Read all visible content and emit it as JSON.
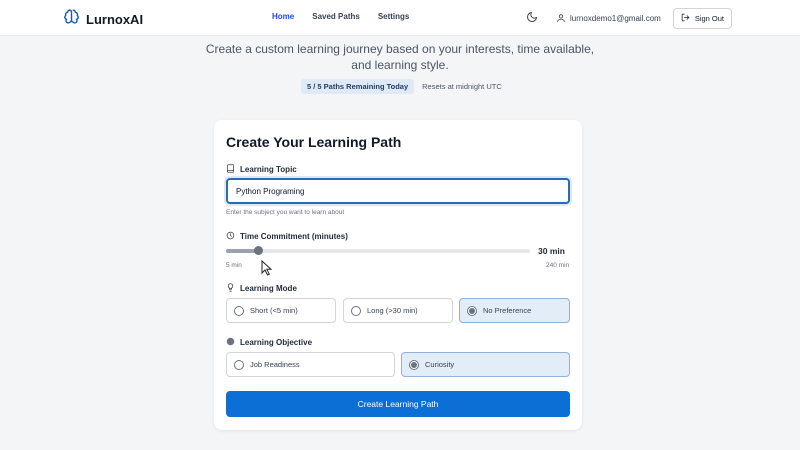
{
  "app": {
    "name": "LurnoxAI"
  },
  "nav": {
    "links": [
      {
        "label": "Home",
        "active": true
      },
      {
        "label": "Saved Paths",
        "active": false
      },
      {
        "label": "Settings",
        "active": false
      }
    ],
    "user_email": "lurnoxdemo1@gmail.com",
    "sign_out_label": "Sign Out"
  },
  "hero": {
    "subtitle_line1": "Create a custom learning journey based on your interests, time available,",
    "subtitle_line2": "and learning style.",
    "quota": "5 / 5 Paths Remaining Today",
    "reset_note": "Resets at midnight UTC"
  },
  "form": {
    "title": "Create Your Learning Path",
    "topic": {
      "label": "Learning Topic",
      "value": "Python Programing",
      "hint": "Enter the subject you want to learn about"
    },
    "time": {
      "label": "Time Commitment (minutes)",
      "min": 5,
      "max": 240,
      "value": 30,
      "value_label": "30 min",
      "min_label": "5 min",
      "max_label": "240 min"
    },
    "mode": {
      "label": "Learning Mode",
      "options": [
        "Short (<5 min)",
        "Long (>30 min)",
        "No Preference"
      ],
      "selected": "No Preference"
    },
    "objective": {
      "label": "Learning Objective",
      "options": [
        "Job Readiness",
        "Curiosity"
      ],
      "selected": "Curiosity"
    },
    "submit_label": "Create Learning Path"
  },
  "icons": {
    "brand": "brain-icon",
    "theme": "moon-icon",
    "user": "user-icon",
    "sign_out": "logout-icon",
    "topic": "book-icon",
    "time": "clock-icon",
    "mode": "lightbulb-icon",
    "objective": "target-icon"
  },
  "colors": {
    "accent": "#0b6fd6",
    "nav_active": "#1d4ed8",
    "selected_bg": "#e3edf8",
    "badge_bg": "#e0eaf7"
  }
}
